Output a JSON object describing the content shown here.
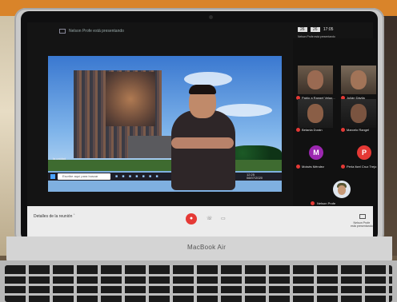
{
  "meeting": {
    "title": "Nelson Profe está presentando"
  },
  "status_bar": {
    "time": "17:05",
    "counter_a": "26",
    "counter_b": "26"
  },
  "notification": "Nelson Profe está presentando",
  "shared_screen": {
    "search_placeholder": "Escribe aquí para buscar",
    "taskbar_clock_time": "12:25",
    "taskbar_clock_date": "08/07/2020",
    "corner_label": "la unidad"
  },
  "participants": [
    {
      "name": "Pablo a Rangel Velaz...",
      "type": "video"
    },
    {
      "name": "Julián Dávila",
      "type": "video"
    },
    {
      "name": "Betania Durán",
      "type": "video"
    },
    {
      "name": "Marcelo Rangel",
      "type": "video"
    },
    {
      "name": "Moisés Méndez",
      "type": "avatar",
      "initial": "M",
      "color": "#9c27b0"
    },
    {
      "name": "Perla Itzel Cruz Trejo",
      "type": "avatar",
      "initial": "P",
      "color": "#e53935"
    },
    {
      "name": "Nelson Profe",
      "type": "presenter"
    }
  ],
  "controls": {
    "details_label": "Detalles de la reunión",
    "presenting_line1": "Nelson Profe",
    "presenting_line2": "está presentando"
  },
  "laptop": {
    "brand": "MacBook Air"
  }
}
